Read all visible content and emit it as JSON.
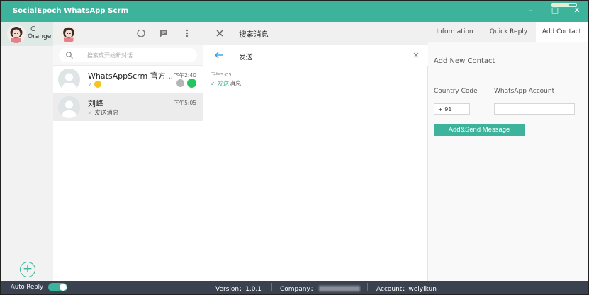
{
  "app": {
    "title": "SocialEpoch WhatsApp Scrm"
  },
  "window": {
    "minimize": "–",
    "maximize": "□",
    "close": "✕"
  },
  "accounts": {
    "active_name": "Orange",
    "refresh_symbol": "C",
    "add_symbol": "+"
  },
  "chat_list": {
    "search_placeholder": "搜索或开始新对话",
    "items": [
      {
        "name": "WhatsAppScrm 官方...",
        "time": "下午2:40",
        "preview_check": "✓",
        "preview": "",
        "has_emoji": true,
        "pinned": true,
        "unread": true
      },
      {
        "name": "刘峰",
        "time": "下午5:05",
        "preview_check": "✓",
        "preview": "发送消息",
        "has_emoji": false,
        "pinned": false,
        "unread": false
      }
    ]
  },
  "message_search": {
    "title": "搜索消息",
    "query": "发送",
    "result": {
      "time": "下午5:05",
      "check": "✓",
      "highlight": "发送",
      "rest": "消息"
    }
  },
  "right_panel": {
    "tabs": [
      {
        "label": "Information",
        "active": false
      },
      {
        "label": "Quick Reply",
        "active": false
      },
      {
        "label": "Add Contact",
        "active": true
      }
    ],
    "section_title": "Add New Contact",
    "country_code_label": "Country Code",
    "country_code_value": "+ 91",
    "whatsapp_account_label": "WhatsApp Account",
    "whatsapp_account_value": "",
    "submit_label": "Add&Send Message"
  },
  "footer": {
    "auto_reply_label": "Auto Reply",
    "auto_reply_on": true,
    "version_label": "Version：",
    "version_value": "1.0.1",
    "company_label": "Company：",
    "account_label": "Account：",
    "account_value": "weiyikun"
  },
  "colors": {
    "accent": "#3cb39a",
    "footer_bg": "#3a4250",
    "unread": "#22c55e"
  },
  "icons": [
    "refresh-icon",
    "chat-icon",
    "menu-icon",
    "search-icon",
    "close-icon",
    "back-arrow-icon",
    "clear-icon",
    "add-account-icon",
    "pin-icon"
  ]
}
